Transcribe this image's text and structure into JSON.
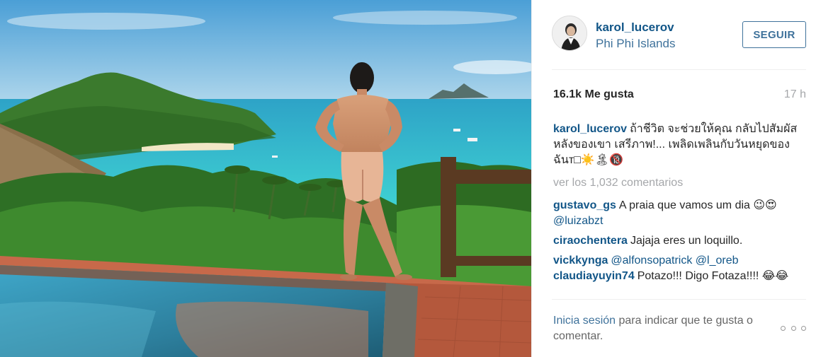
{
  "post": {
    "username": "karol_lucerov",
    "location": "Phi Phi Islands",
    "follow_label": "SEGUIR",
    "likes": "16.1k Me gusta",
    "time_ago": "17 h",
    "caption": {
      "user": "karol_lucerov",
      "text": "ถ้าชีวิต จะช่วยให้คุณ กลับไปสัมผัส หลังของเขา เสรีภาพ!... เพลิดเพลินกับวันหยุดของฉันт□☀️🏝🔞"
    },
    "view_all": "ver los 1,032 comentarios",
    "comments": [
      {
        "user": "gustavo_gs",
        "text": "A praia que vamos um dia 😉😍 ",
        "mention": "@luizabzt"
      },
      {
        "user": "ciraochentera",
        "text": "Jajaja eres un loquillo.",
        "mention": ""
      },
      {
        "user": "vickkynga",
        "text": "",
        "mention": "@alfonsopatrick @l_oreb"
      },
      {
        "user": "claudiayuyin74",
        "text": "Potazo!!! Digo Fotaza!!!! 😂😂",
        "mention": ""
      }
    ],
    "login_link": "Inicia sesión",
    "login_rest": " para indicar que te gusta o comentar."
  },
  "colors": {
    "username": "#125688",
    "link": "#3f729b",
    "muted": "#a5a7aa"
  },
  "icons": {
    "more": "ellipsis-icon",
    "avatar": "avatar"
  }
}
